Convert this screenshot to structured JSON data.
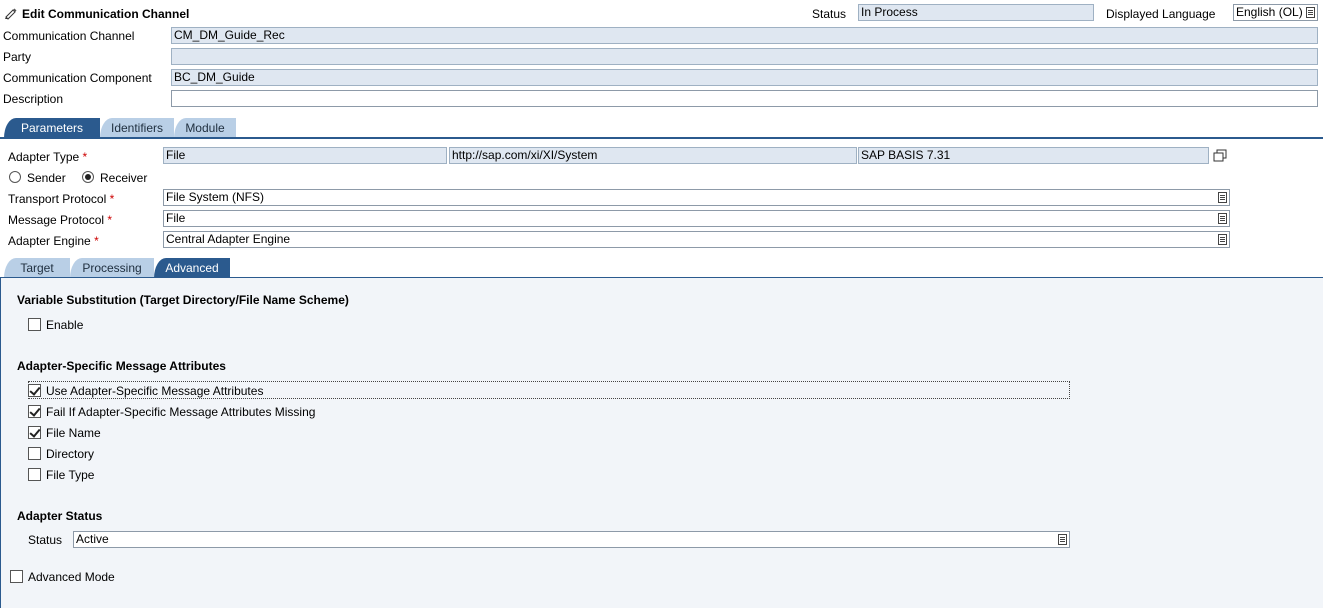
{
  "header": {
    "title": "Edit Communication Channel",
    "status_label": "Status",
    "status_value": "In Process",
    "language_label": "Displayed Language",
    "language_value": "English (OL)"
  },
  "top_fields": {
    "channel_label": "Communication Channel",
    "channel_value": "CM_DM_Guide_Rec",
    "party_label": "Party",
    "party_value": "",
    "component_label": "Communication Component",
    "component_value": "BC_DM_Guide",
    "description_label": "Description",
    "description_value": ""
  },
  "main_tabs": [
    "Parameters",
    "Identifiers",
    "Module"
  ],
  "params": {
    "adapter_type_label": "Adapter Type",
    "required_marker": "*",
    "adapter_type_value": "File",
    "adapter_namespace": "http://sap.com/xi/XI/System",
    "adapter_swcv": "SAP BASIS 7.31",
    "sender_label": "Sender",
    "receiver_label": "Receiver",
    "direction_selected": "Receiver",
    "transport_label": "Transport Protocol",
    "transport_value": "File System (NFS)",
    "message_label": "Message Protocol",
    "message_value": "File",
    "engine_label": "Adapter Engine",
    "engine_value": "Central Adapter Engine"
  },
  "sub_tabs": [
    "Target",
    "Processing",
    "Advanced"
  ],
  "advanced": {
    "varsub_title": "Variable Substitution (Target Directory/File Name Scheme)",
    "enable_label": "Enable",
    "asma_title": "Adapter-Specific Message Attributes",
    "asma_items": [
      {
        "label": "Use Adapter-Specific Message Attributes",
        "checked": true
      },
      {
        "label": "Fail If Adapter-Specific Message Attributes Missing",
        "checked": true
      },
      {
        "label": "File Name",
        "checked": true
      },
      {
        "label": "Directory",
        "checked": false
      },
      {
        "label": "File Type",
        "checked": false
      }
    ],
    "adapter_status_title": "Adapter Status",
    "status_label": "Status",
    "status_value": "Active",
    "advanced_mode_label": "Advanced Mode"
  }
}
